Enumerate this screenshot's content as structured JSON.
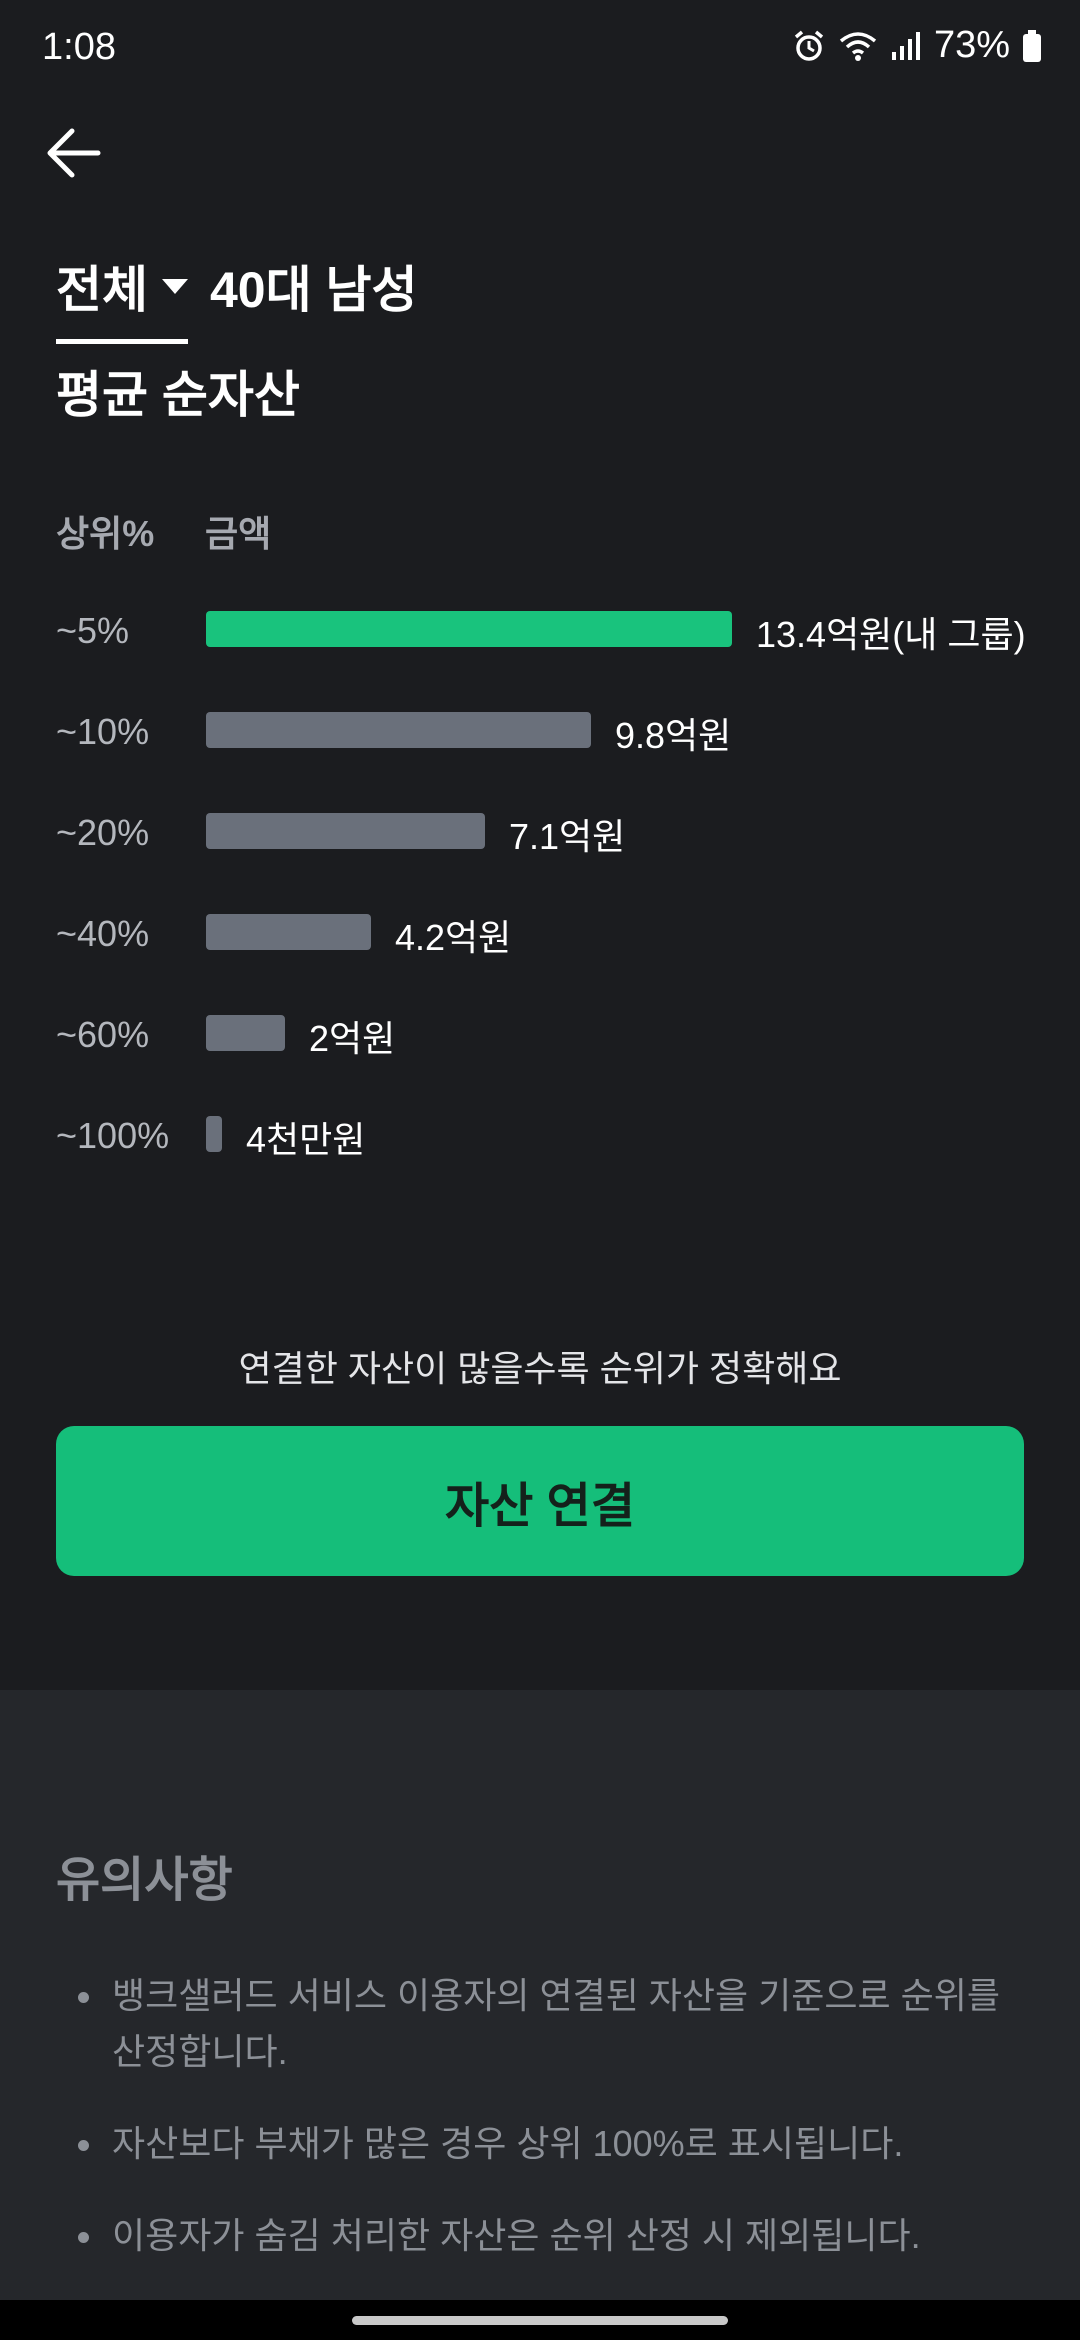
{
  "status_bar": {
    "time": "1:08",
    "battery": "73%"
  },
  "filter": {
    "selected": "전체",
    "group": "40대 남성"
  },
  "title": "평균 순자산",
  "columns": {
    "rank": "상위%",
    "amount": "금액"
  },
  "rows": [
    {
      "label": "~5%",
      "value_text": "13.4억원(내 그룹)",
      "value": 13.4,
      "highlight": true
    },
    {
      "label": "~10%",
      "value_text": "9.8억원",
      "value": 9.8,
      "highlight": false
    },
    {
      "label": "~20%",
      "value_text": "7.1억원",
      "value": 7.1,
      "highlight": false
    },
    {
      "label": "~40%",
      "value_text": "4.2억원",
      "value": 4.2,
      "highlight": false
    },
    {
      "label": "~60%",
      "value_text": "2억원",
      "value": 2.0,
      "highlight": false
    },
    {
      "label": "~100%",
      "value_text": "4천만원",
      "value": 0.4,
      "highlight": false
    }
  ],
  "hint": "연결한 자산이 많을수록 순위가 정확해요",
  "cta_label": "자산 연결",
  "notice": {
    "title": "유의사항",
    "items": [
      "뱅크샐러드 서비스 이용자의 연결된 자산을 기준으로 순위를 산정합니다.",
      "자산보다 부채가 많은 경우 상위 100%로 표시됩니다.",
      "이용자가 숨김 처리한 자산은 순위 산정 시 제외됩니다."
    ]
  },
  "colors": {
    "accent": "#15be7a",
    "bar_highlight": "#19c37d",
    "bar_default": "#6a707b",
    "background": "#1b1c1f"
  },
  "icons": [
    "alarm-icon",
    "wifi-icon",
    "signal-icon",
    "battery-icon",
    "back-arrow-icon",
    "caret-down-icon"
  ]
}
